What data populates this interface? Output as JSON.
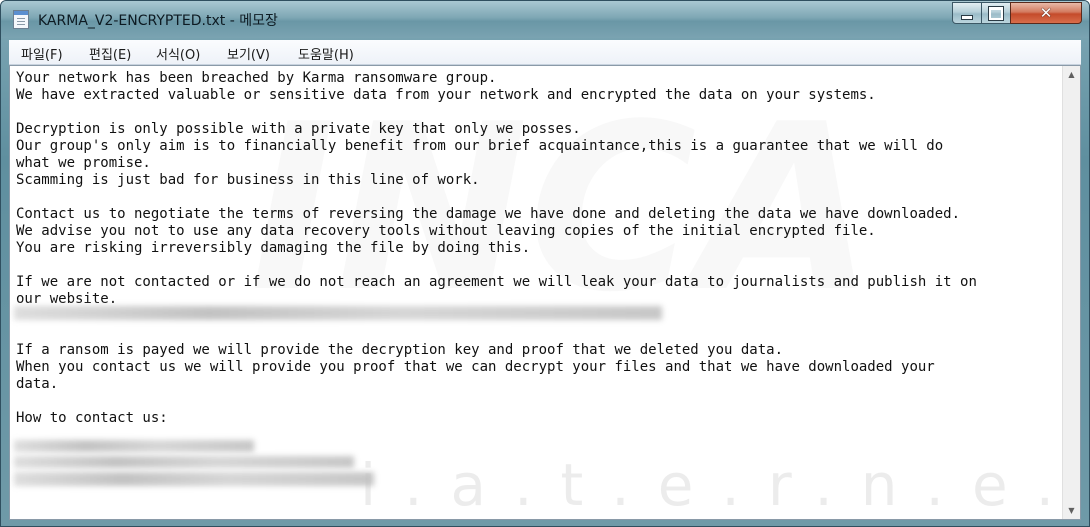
{
  "window": {
    "title": "KARMA_V2-ENCRYPTED.txt - 메모장",
    "controls": {
      "minimize_icon": "minimize-icon",
      "maximize_icon": "maximize-icon",
      "close_glyph": "✕"
    }
  },
  "menu": {
    "items": [
      {
        "label": "파일(F)"
      },
      {
        "label": "편집(E)"
      },
      {
        "label": "서식(O)"
      },
      {
        "label": "보기(V)"
      },
      {
        "label": "도움말(H)"
      }
    ]
  },
  "document": {
    "lines": [
      "Your network has been breached by Karma ransomware group.",
      "We have extracted valuable or sensitive data from your network and encrypted the data on your systems.",
      "",
      "Decryption is only possible with a private key that only we posses.",
      "Our group's only aim is to financially benefit from our brief acquaintance,this is a guarantee that we will do",
      "what we promise.",
      "Scamming is just bad for business in this line of work.",
      "",
      "Contact us to negotiate the terms of reversing the damage we have done and deleting the data we have downloaded.",
      "We advise you not to use any data recovery tools without leaving copies of the initial encrypted file.",
      "You are risking irreversibly damaging the file by doing this.",
      "",
      "If we are not contacted or if we do not reach an agreement we will leak your data to journalists and publish it on",
      "our website.",
      "",
      "",
      "If a ransom is payed we will provide the decryption key and proof that we deleted you data.",
      "When you contact us we will provide you proof that we can decrypt your files and that we have downloaded your",
      "data.",
      "",
      "How to contact us:"
    ],
    "watermark_main": "INCA",
    "watermark_sub": "i.a.t.e.r.n.e.t"
  },
  "colors": {
    "titlebar": "#7ea7b4",
    "close_button": "#c44b2b",
    "text": "#111111"
  }
}
